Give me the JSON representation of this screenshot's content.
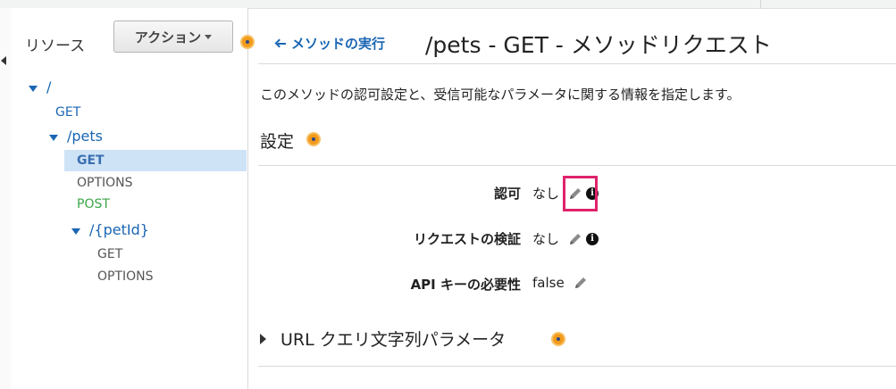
{
  "resources": {
    "title": "リソース",
    "actions_label": "アクション",
    "tree": [
      {
        "label": "/",
        "kind": "path"
      },
      {
        "label": "GET",
        "kind": "method"
      },
      {
        "label": "/pets",
        "kind": "path"
      },
      {
        "label": "GET",
        "kind": "method",
        "selected": true
      },
      {
        "label": "OPTIONS",
        "kind": "method"
      },
      {
        "label": "POST",
        "kind": "method"
      },
      {
        "label": "/{petId}",
        "kind": "path"
      },
      {
        "label": "GET",
        "kind": "method"
      },
      {
        "label": "OPTIONS",
        "kind": "method"
      }
    ]
  },
  "main": {
    "back_link": "メソッドの実行",
    "title": "/pets - GET - メソッドリクエスト",
    "description": "このメソッドの認可設定と、受信可能なパラメータに関する情報を指定します。",
    "settings_title": "設定",
    "settings": [
      {
        "label": "認可",
        "value": "なし"
      },
      {
        "label": "リクエストの検証",
        "value": "なし"
      },
      {
        "label": "API キーの必要性",
        "value": "false"
      }
    ],
    "url_params_title": "URL クエリ文字列パラメータ"
  },
  "icons": {
    "help_dot": "help-dot-icon",
    "pencil": "pencil-icon",
    "info": "info-icon",
    "back": "arrow-left-icon"
  },
  "colors": {
    "link": "#1a66b3",
    "post": "#3aa548",
    "selected_row": "#cfe3f7",
    "highlight": "#e0226b",
    "help_dot": "#f29a1b"
  }
}
